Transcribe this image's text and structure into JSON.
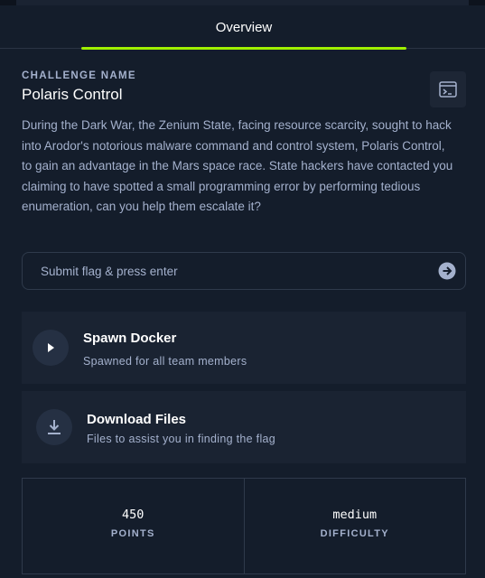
{
  "tabs": [
    {
      "label": "Overview",
      "active": true
    }
  ],
  "challenge": {
    "section_label": "CHALLENGE NAME",
    "name": "Polaris Control",
    "description": "During the Dark War, the Zenium State, facing resource scarcity, sought to hack into Arodor's notorious malware command and control system, Polaris Control, to gain an advantage in the Mars space race. State hackers have contacted you claiming to have spotted a small programming error by performing tedious enumeration, can you help them escalate it?"
  },
  "flag_input": {
    "placeholder": "Submit flag & press enter",
    "value": ""
  },
  "spawn": {
    "title": "Spawn Docker",
    "subtitle": "Spawned for all team members"
  },
  "download": {
    "title": "Download Files",
    "subtitle": "Files to assist you in finding the flag"
  },
  "stats": {
    "points": {
      "value": "450",
      "label": "POINTS"
    },
    "difficulty": {
      "value": "medium",
      "label": "DIFFICULTY"
    }
  },
  "icons": {
    "terminal": "terminal-icon",
    "submit": "arrow-right-circle-icon",
    "spawn": "play-icon",
    "download": "download-icon"
  },
  "colors": {
    "background": "#141d2b",
    "card": "#1a2332",
    "accent": "#9fef00",
    "muted_text": "#a4b1cd"
  }
}
